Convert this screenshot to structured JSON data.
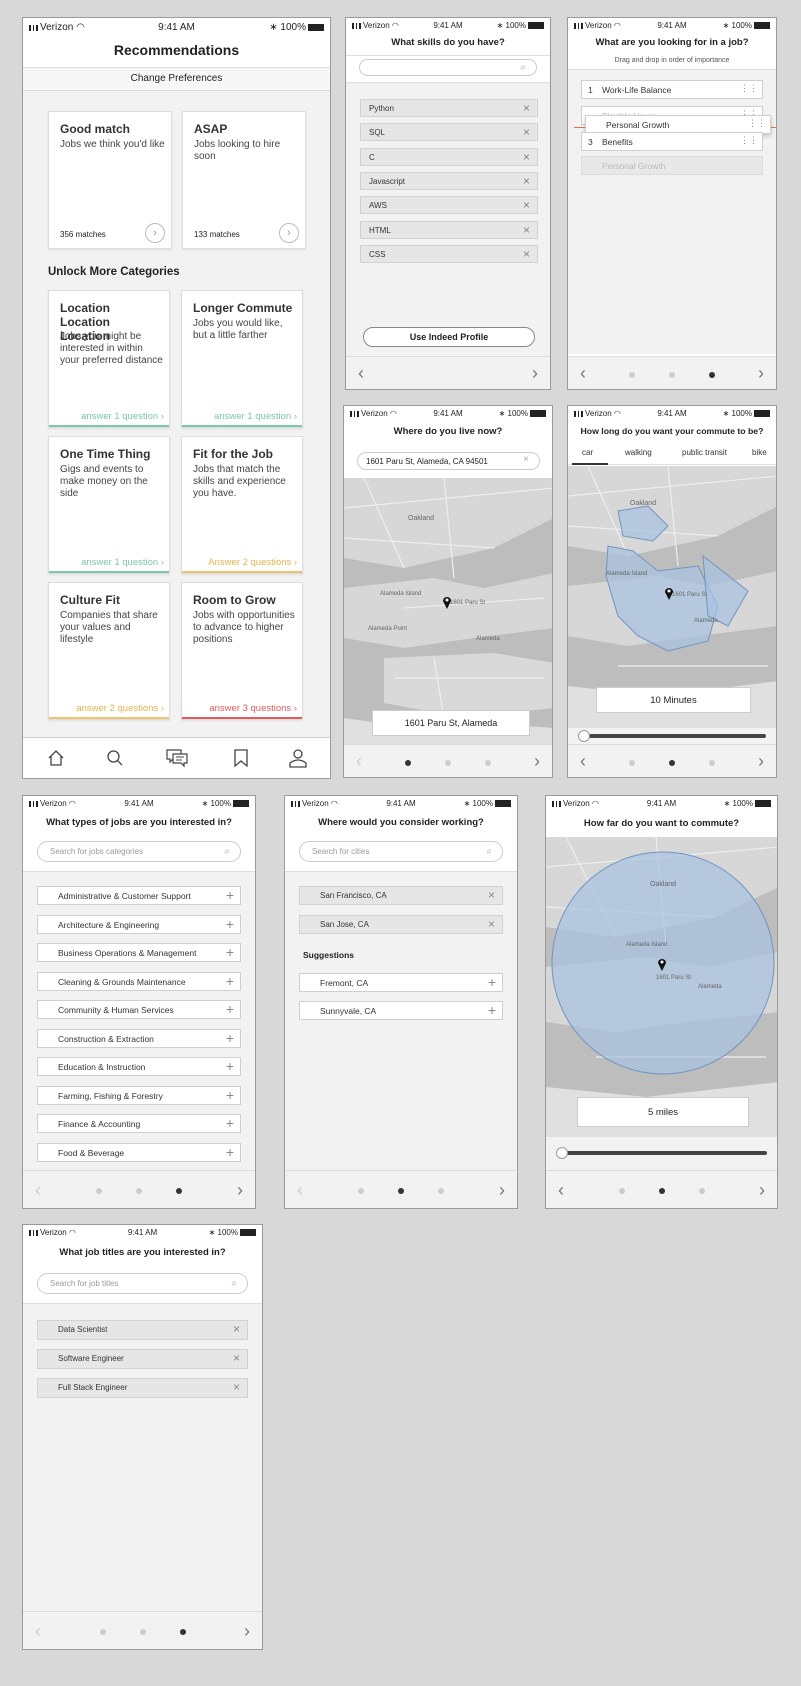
{
  "status": {
    "carrier": "Verizon",
    "time": "9:41 AM",
    "battery": "100%"
  },
  "recs": {
    "title": "Recommendations",
    "change": "Change Preferences",
    "cards": [
      {
        "title": "Good match",
        "desc": "Jobs we think you'd like",
        "meta": "356 matches"
      },
      {
        "title": "ASAP",
        "desc": "Jobs looking to hire soon",
        "meta": "133 matches"
      }
    ],
    "unlock": "Unlock More Categories",
    "cats": [
      {
        "title": "Location Location Location",
        "desc": "Jobs you might be interested in within your preferred distance",
        "cta": "answer 1 question ›",
        "color": "#7bc8a4"
      },
      {
        "title": "Longer Commute",
        "desc": "Jobs you would like, but a little farther",
        "cta": "answer 1 question ›",
        "color": "#7bc8a4"
      },
      {
        "title": "One Time Thing",
        "desc": "Gigs and events to make money on the side",
        "cta": "answer 1 question ›",
        "color": "#7bc8a4"
      },
      {
        "title": "Fit for the Job",
        "desc": "Jobs that match the skills and experience you have.",
        "cta": "Answer 2 questions ›",
        "color": "#f0c36d"
      },
      {
        "title": "Culture Fit",
        "desc": "Companies that share your values and lifestyle",
        "cta": "answer 2 questions ›",
        "color": "#f0c36d"
      },
      {
        "title": "Room to Grow",
        "desc": "Jobs with opportunities to advance to higher positions",
        "cta": "answer 3 questions ›",
        "color": "#e05b5b"
      }
    ]
  },
  "skills": {
    "title": "What skills do you have?",
    "items": [
      "Python",
      "SQL",
      "C",
      "Javascript",
      "AWS",
      "HTML",
      "CSS"
    ],
    "button": "Use Indeed Profile"
  },
  "looking": {
    "title": "What are you looking for in a job?",
    "sub": "Drag and drop in order of importance",
    "items": [
      {
        "n": "1",
        "label": "Work-Life Balance"
      },
      {
        "n": "",
        "label": "Flexible Hours"
      },
      {
        "n": "3",
        "label": "Benefits"
      }
    ],
    "dragging": "Personal Growth",
    "ghost": "Personal Growth"
  },
  "live": {
    "title": "Where do you live now?",
    "input": "1601 Paru St, Alameda, CA 94501",
    "result": "1601 Paru St, Alameda",
    "places": [
      "Oakland",
      "Alameda",
      "Alameda Island",
      "Alameda Point",
      "1601 Paru St"
    ]
  },
  "howlong": {
    "title": "How long do you want your commute to be?",
    "tabs": [
      "car",
      "walking",
      "public transit",
      "bike"
    ],
    "value": "10 Minutes",
    "places": [
      "Oakland",
      "Alameda",
      "Alameda Island",
      "1601 Paru St"
    ]
  },
  "types": {
    "title": "What types of jobs are you interested in?",
    "placeholder": "Search for jobs categories",
    "items": [
      "Administrative & Customer Support",
      "Architecture & Engineering",
      "Business Operations & Management",
      "Cleaning & Grounds Maintenance",
      "Community & Human Services",
      "Construction & Extraction",
      "Education & Instruction",
      "Farming, Fishing & Forestry",
      "Finance & Accounting",
      "Food & Beverage"
    ]
  },
  "where": {
    "title": "Where would you consider working?",
    "placeholder": "Search for cities",
    "selected": [
      "San Francisco, CA",
      "San Jose, CA"
    ],
    "sugg_label": "Suggestions",
    "suggestions": [
      "Fremont, CA",
      "Sunnyvale, CA"
    ]
  },
  "howfar": {
    "title": "How far do you want to commute?",
    "value": "5 miles",
    "places": [
      "Oakland",
      "Alameda",
      "Alameda Island",
      "1601 Paru St"
    ]
  },
  "titles": {
    "title": "What job titles are you interested in?",
    "placeholder": "Search for job titles",
    "items": [
      "Data Scientist",
      "Software Engineer",
      "Full Stack Engineer"
    ]
  },
  "colors": {
    "accent_orange": "#e8763a",
    "green": "#7bc8a4",
    "yellow": "#f0c36d",
    "red": "#e05b5b",
    "map_blue": "#a9c3e0"
  }
}
